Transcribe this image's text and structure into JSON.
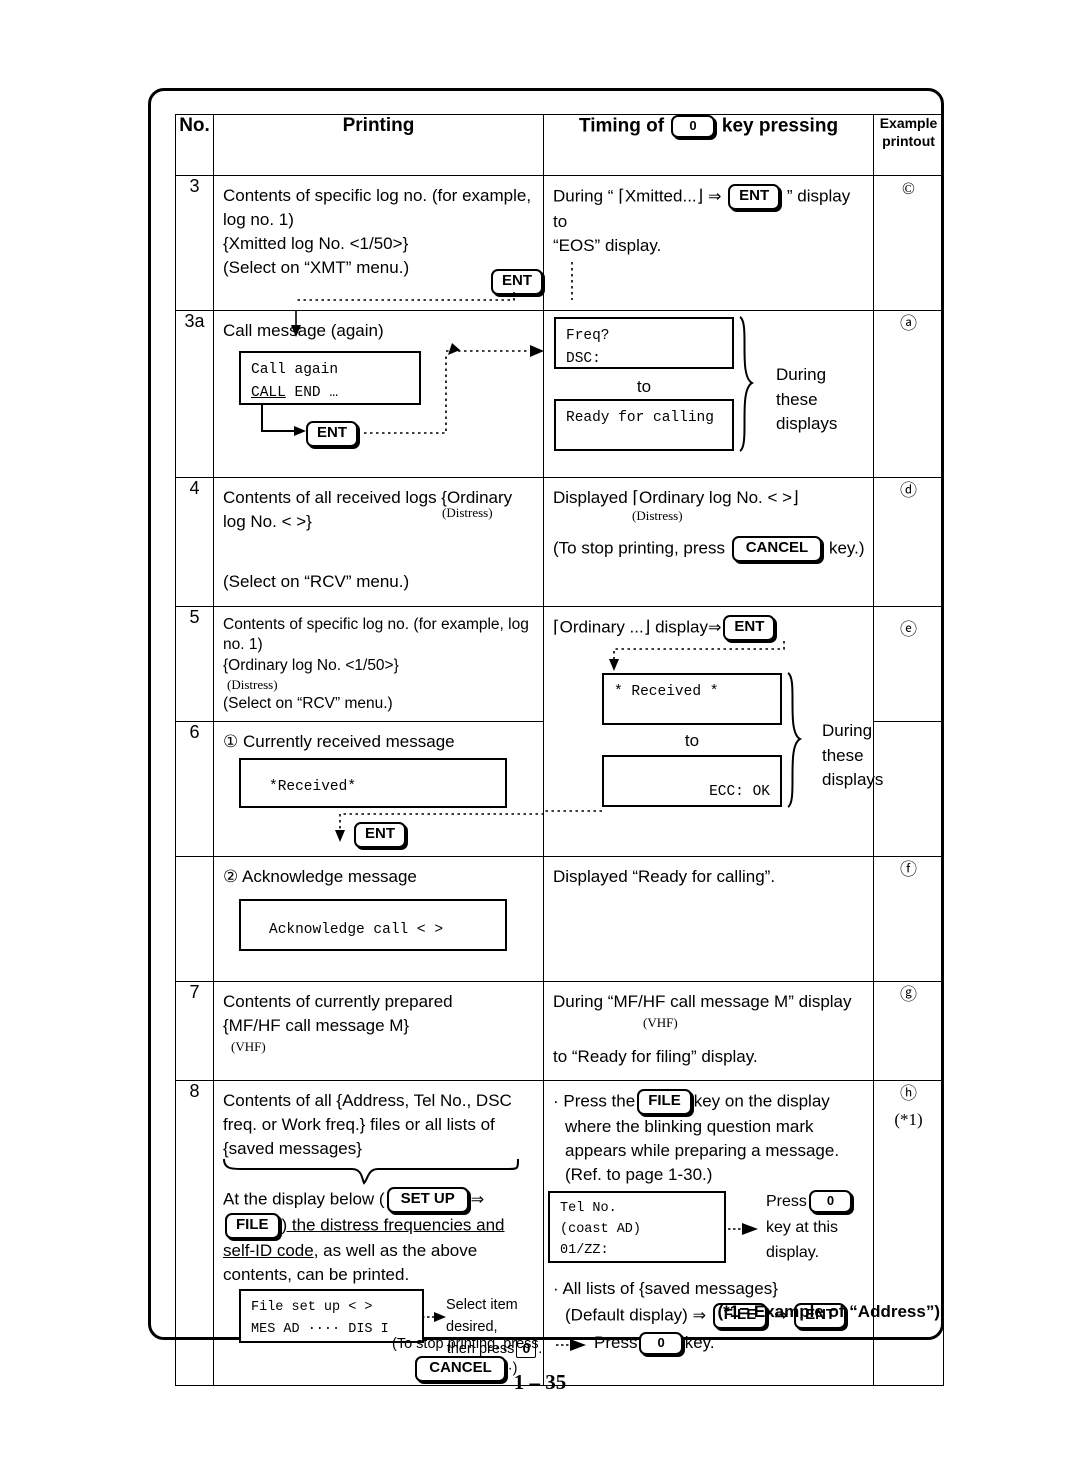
{
  "page": {
    "number": "1 – 35",
    "footnote": "(*1= Example of “Address”)"
  },
  "table": {
    "headers": {
      "no": "No.",
      "printing": "Printing",
      "timing_prefix": "Timing of",
      "timing_key": "0",
      "timing_suffix": "key pressing",
      "example_line1": "Example",
      "example_line2": "printout"
    },
    "rows": [
      {
        "no": "3",
        "printing": {
          "lines": [
            "Contents of specific log no. (for example,",
            "log no. 1)",
            "{Xmitted log No. <1/50>}",
            "(Select on “XMT” menu.)"
          ],
          "key": "ENT"
        },
        "timing": {
          "prefix": "During “",
          "bracketed": "⌈Xmitted...⌋",
          "arrow": "⇒",
          "key": "ENT",
          "suffix": "” display",
          "line2": "to",
          "line3": "“EOS” display."
        },
        "example": "©"
      },
      {
        "no": "3a",
        "printing": {
          "title": "Call message (again)",
          "lcd": [
            "Call again",
            "CALL END …"
          ],
          "lcd_underline": "CALL",
          "key": "ENT"
        },
        "timing": {
          "lcd_top": [
            "Freq?",
            "DSC:"
          ],
          "middle": "to",
          "lcd_bottom": [
            "Ready for calling"
          ],
          "brace_label": [
            "During",
            "these",
            "displays"
          ]
        },
        "example": "ⓐ"
      },
      {
        "no": "4",
        "printing": {
          "line1": "Contents of all received logs {Ordinary",
          "line2": "log No. <          >}",
          "anno1": "(Distress)",
          "line3": "(Select on “RCV” menu.)"
        },
        "timing": {
          "line1": "Displayed ⌈Ordinary log No. <          >⌋",
          "anno1": "(Distress)",
          "stop_prefix": "(To stop printing, press",
          "stop_key": "CANCEL",
          "stop_suffix": "key.)"
        },
        "example": "ⓓ"
      },
      {
        "no": "5",
        "printing": {
          "lines": [
            "Contents of specific log no. (for example, log",
            "no. 1)",
            "{Ordinary log No. <1/50>}"
          ],
          "anno1": "(Distress)",
          "line4": "(Select on “RCV” menu.)"
        },
        "timing": {
          "bracketed": "⌈Ordinary ...⌋",
          "display_word": "display",
          "arrow": "⇒",
          "key": "ENT"
        },
        "example": "ⓔ"
      },
      {
        "no": "6",
        "printing": {
          "title": "① Currently received message",
          "lcd": [
            "*Received*"
          ],
          "key": "ENT"
        },
        "timing": {
          "lcd_top": [
            "* Received *"
          ],
          "middle": "to",
          "lcd_bottom": [
            "ECC: OK"
          ],
          "brace_label": [
            "During",
            "these",
            "displays"
          ]
        },
        "example": ""
      },
      {
        "no": "",
        "printing": {
          "title": "② Acknowledge message",
          "lcd": [
            "Acknowledge call <            >"
          ]
        },
        "timing": {
          "line1": "Displayed “Ready for calling”."
        },
        "example": "ⓕ"
      },
      {
        "no": "7",
        "printing": {
          "line1": "Contents of currently prepared",
          "line2": "{MF/HF call message M}",
          "anno1": "(VHF)"
        },
        "timing": {
          "line1": "During “MF/HF call message M” display",
          "anno1": "(VHF)",
          "line2": "to “Ready for filing” display."
        },
        "example": "ⓖ"
      },
      {
        "no": "8",
        "printing": {
          "lines": [
            "Contents of all {Address, Tel No., DSC",
            "freq. or Work freq.} files or all lists of",
            "{saved messages}"
          ],
          "below_prefix": "At the display below (",
          "key_setup": "SET UP",
          "arrow": "⇒",
          "key_file": "FILE",
          "below_mid": ") the distress frequencies and",
          "below_ul2": "self-ID code",
          "below_rest": ", as well as the above",
          "below_last": "contents, can be printed.",
          "lcd": [
            "File set up <      >",
            "MES AD ···· DIS I"
          ],
          "note1": "Select item desired,",
          "note2_prefix": "then press",
          "note2_key": "0",
          "note2_suffix": ".",
          "stop_prefix": "(To stop printing, press",
          "stop_key": "CANCEL",
          "stop_suffix": "·)"
        },
        "timing": {
          "b1_prefix": "· Press the",
          "b1_key": "FILE",
          "b1_suffix": "key on the display",
          "b1_l2": "where the blinking question mark",
          "b1_l3": "appears while preparing a message.",
          "b1_l4": "(Ref. to page 1-30.)",
          "lcd": [
            "Tel No.",
            "(coast AD)",
            "01/ZZ:"
          ],
          "press_word": "Press",
          "press_key": "0",
          "press_l2": "key at this",
          "press_l3": "display.",
          "b2": "· All lists of {saved messages}",
          "b2_l2_prefix": "(Default display)",
          "b2_arrow1": "⇒",
          "b2_key1": "FILE",
          "b2_arrow2": "⇒",
          "b2_key2": "ENT",
          "b2_l3_prefix": "Press",
          "b2_l3_key": "0",
          "b2_l3_suffix": "key."
        },
        "example": "ⓗ",
        "example2": "(*1)"
      }
    ]
  }
}
